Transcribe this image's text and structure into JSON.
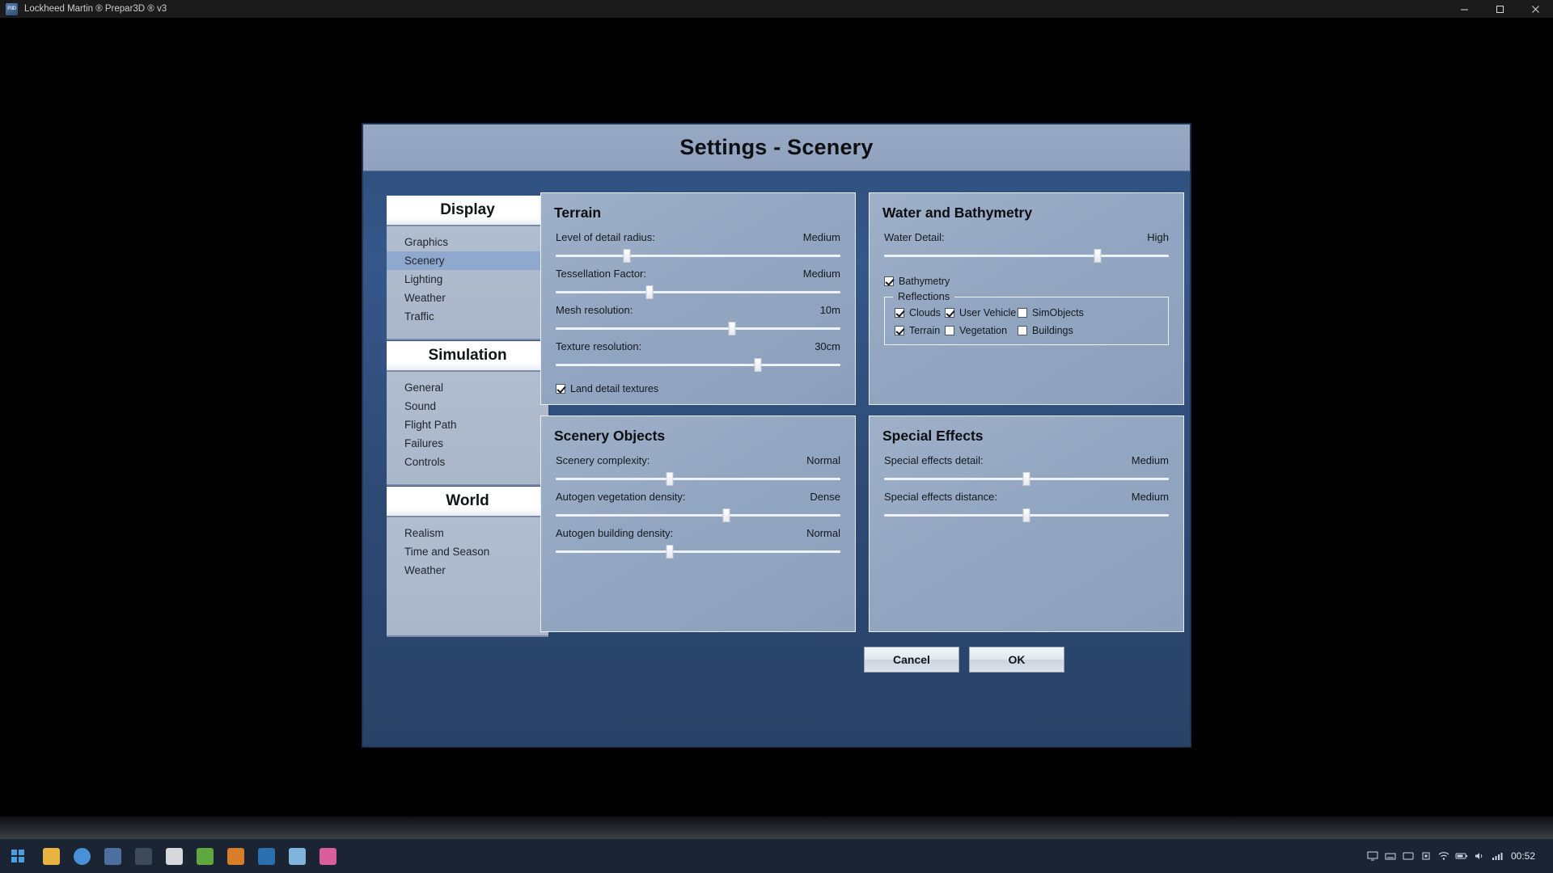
{
  "window": {
    "title": "Lockheed Martin ® Prepar3D ® v3",
    "icon": "p3d-app-icon",
    "minimize_label": "—",
    "maximize_label": "❐",
    "close_label": "✕"
  },
  "dialog": {
    "title": "Settings - Scenery",
    "cancel_label": "Cancel",
    "ok_label": "OK"
  },
  "sidebar": {
    "groups": [
      {
        "header": "Display",
        "items": [
          {
            "label": "Graphics",
            "selected": false
          },
          {
            "label": "Scenery",
            "selected": true
          },
          {
            "label": "Lighting",
            "selected": false
          },
          {
            "label": "Weather",
            "selected": false
          },
          {
            "label": "Traffic",
            "selected": false
          }
        ]
      },
      {
        "header": "Simulation",
        "items": [
          {
            "label": "General",
            "selected": false
          },
          {
            "label": "Sound",
            "selected": false
          },
          {
            "label": "Flight Path",
            "selected": false
          },
          {
            "label": "Failures",
            "selected": false
          },
          {
            "label": "Controls",
            "selected": false
          }
        ]
      },
      {
        "header": "World",
        "items": [
          {
            "label": "Realism",
            "selected": false
          },
          {
            "label": "Time and Season",
            "selected": false
          },
          {
            "label": "Weather",
            "selected": false
          }
        ]
      }
    ]
  },
  "panels": {
    "terrain": {
      "title": "Terrain",
      "sliders": [
        {
          "label": "Level of detail radius:",
          "value": "Medium",
          "percent": 25
        },
        {
          "label": "Tessellation Factor:",
          "value": "Medium",
          "percent": 33
        },
        {
          "label": "Mesh resolution:",
          "value": "10m",
          "percent": 62
        },
        {
          "label": "Texture resolution:",
          "value": "30cm",
          "percent": 71
        }
      ],
      "checkbox": {
        "label": "Land detail textures",
        "checked": true
      }
    },
    "water": {
      "title": "Water and Bathymetry",
      "sliders": [
        {
          "label": "Water Detail:",
          "value": "High",
          "percent": 75
        }
      ],
      "bathymetry": {
        "label": "Bathymetry",
        "checked": true
      },
      "reflections": {
        "legend": "Reflections",
        "items": [
          {
            "label": "Clouds",
            "checked": true
          },
          {
            "label": "User Vehicle",
            "checked": true
          },
          {
            "label": "SimObjects",
            "checked": false
          },
          {
            "label": "Terrain",
            "checked": true
          },
          {
            "label": "Vegetation",
            "checked": false
          },
          {
            "label": "Buildings",
            "checked": false
          }
        ]
      }
    },
    "scenery_objects": {
      "title": "Scenery Objects",
      "sliders": [
        {
          "label": "Scenery complexity:",
          "value": "Normal",
          "percent": 40
        },
        {
          "label": "Autogen vegetation density:",
          "value": "Dense",
          "percent": 60
        },
        {
          "label": "Autogen building density:",
          "value": "Normal",
          "percent": 40
        }
      ]
    },
    "special_effects": {
      "title": "Special Effects",
      "sliders": [
        {
          "label": "Special effects detail:",
          "value": "Medium",
          "percent": 50
        },
        {
          "label": "Special effects distance:",
          "value": "Medium",
          "percent": 50
        }
      ]
    }
  },
  "taskbar": {
    "start": "start-button",
    "apps": [
      {
        "name": "file-explorer",
        "color": "#e8b341"
      },
      {
        "name": "chrome-browser",
        "color": "#4a90d9"
      },
      {
        "name": "prepar3d-app",
        "color": "#4c6fa0"
      },
      {
        "name": "tool-app",
        "color": "#3c4a5c"
      },
      {
        "name": "notepad-app",
        "color": "#d8d8d8"
      },
      {
        "name": "green-app",
        "color": "#5fa83f"
      },
      {
        "name": "orange-app",
        "color": "#d97d2a"
      },
      {
        "name": "blue-app",
        "color": "#2a6fb0"
      },
      {
        "name": "chart-app",
        "color": "#7fb5dd"
      },
      {
        "name": "pink-app",
        "color": "#d95f9a"
      }
    ],
    "tray_icons": [
      "monitor-icon",
      "keyboard-icon",
      "display-icon",
      "chip-icon",
      "wifi-icon",
      "battery-icon",
      "volume-icon",
      "network-icon"
    ],
    "clock": "00:52",
    "show_desktop": "show-desktop-button"
  }
}
